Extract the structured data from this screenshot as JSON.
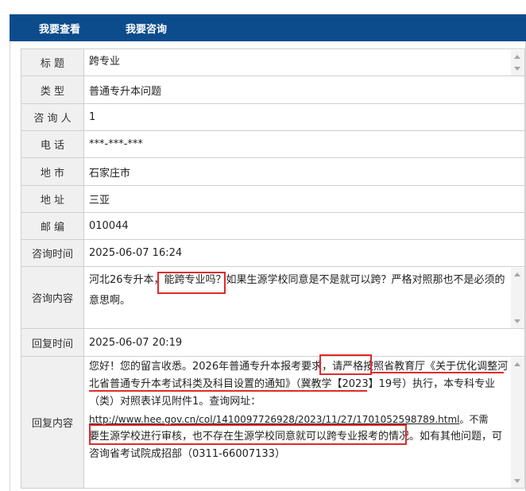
{
  "tabs": {
    "view": "我要查看",
    "consult": "我要咨询"
  },
  "rows": {
    "title": {
      "label": "标 题",
      "value": "跨专业"
    },
    "type": {
      "label": "类 型",
      "value": "普通专升本问题"
    },
    "consultant": {
      "label": "咨 询 人",
      "value": "1"
    },
    "phone": {
      "label": "电 话",
      "value": "***-***-***"
    },
    "city": {
      "label": "地 市",
      "value": "石家庄市"
    },
    "address": {
      "label": "地 址",
      "value": "三亚"
    },
    "postcode": {
      "label": "邮 编",
      "value": "010044"
    },
    "consult_time": {
      "label": "咨询时间",
      "value": "2025-06-07 16:24"
    },
    "consult_content": {
      "label": "咨询内容",
      "line1": "河北26专升本，能跨专业吗？如果生源学校同意是不是就可以跨？严格对照那也不是必须的",
      "line2": "意思啊。"
    },
    "reply_time": {
      "label": "回复时间",
      "value": "2025-06-07 20:19"
    },
    "reply_content": {
      "label": "回复内容",
      "line1": "您好！您的留言收悉。2026年普通专升本报考要求，请严格按照省教育厅《关于优化调整河",
      "line2": "北省普通专升本考试科类及科目设置的通知》（冀教学【2023】19号）执行，本专科专业",
      "line3": "（类）对照表详见附件1。查询网址：",
      "url": "http://www.hee.gov.cn/col/1410097726928/2023/11/27/1701052598789.html",
      "line4_tail": "。不需",
      "line5": "要生源学校进行审核，也不存在生源学校同意就可以跨专业报考的情况。如有其他问题，可",
      "line6": "咨询省考试院成招部（0311-66007133）"
    }
  },
  "colors": {
    "tab_bar": "#0d4c8c",
    "label_bg": "#f0f0f0",
    "highlight": "#e02b2b"
  }
}
